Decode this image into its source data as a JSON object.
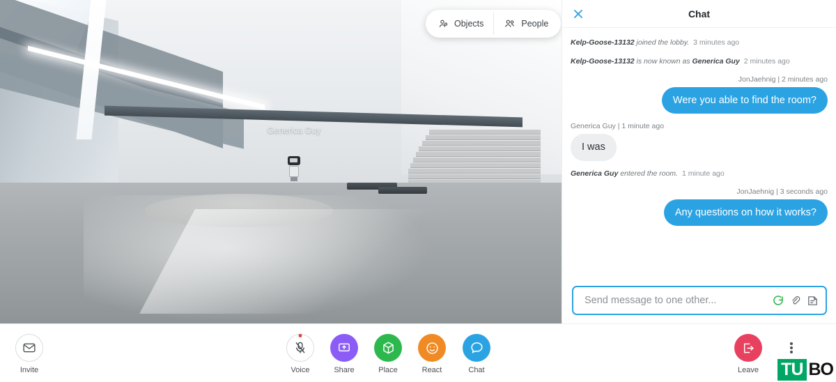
{
  "scene": {
    "avatar_name": "Generica Guy",
    "pills": [
      {
        "label": "Objects",
        "icon": "objects-icon"
      },
      {
        "label": "People",
        "icon": "people-icon"
      }
    ]
  },
  "chat": {
    "title": "Chat",
    "close_icon": "close-icon",
    "messages": [
      {
        "kind": "system",
        "who": "Kelp-Goose-13132",
        "text": "joined the lobby.",
        "time": "3 minutes ago"
      },
      {
        "kind": "system",
        "who": "Kelp-Goose-13132",
        "text": "is now known as",
        "who2": "Generica Guy",
        "time": "2 minutes ago"
      },
      {
        "kind": "message",
        "direction": "out",
        "meta": "JonJaehnig | 2 minutes ago",
        "text": "Were you able to find the room?"
      },
      {
        "kind": "message",
        "direction": "in",
        "meta": "Generica Guy | 1 minute ago",
        "text": "I was"
      },
      {
        "kind": "system",
        "who": "Generica Guy",
        "text": "entered the room.",
        "time": "1 minute ago"
      },
      {
        "kind": "message",
        "direction": "out",
        "meta": "JonJaehnig | 3 seconds ago",
        "text": "Any questions on how it works?"
      }
    ],
    "composer": {
      "value": "",
      "placeholder": "Send message to one other...",
      "spinner_icon": "loading-spinner-icon",
      "attach_icon": "paperclip-icon",
      "emoji_icon": "sticker-icon"
    }
  },
  "bottom_bar": {
    "items": [
      {
        "name": "invite",
        "label": "Invite",
        "icon": "envelope-icon",
        "color": "#ffffff",
        "style": "outline"
      },
      {
        "name": "voice",
        "label": "Voice",
        "icon": "microphone-muted-icon",
        "color": "#ffffff",
        "style": "outline",
        "badge": true
      },
      {
        "name": "share",
        "label": "Share",
        "icon": "screen-share-icon",
        "color": "#8b5cf6",
        "style": "solid"
      },
      {
        "name": "place",
        "label": "Place",
        "icon": "cube-icon",
        "color": "#2db84d",
        "style": "solid"
      },
      {
        "name": "react",
        "label": "React",
        "icon": "smiley-icon",
        "color": "#f08a24",
        "style": "solid"
      },
      {
        "name": "chat",
        "label": "Chat",
        "icon": "chat-bubble-icon",
        "color": "#2ba3e3",
        "style": "solid"
      },
      {
        "name": "leave",
        "label": "Leave",
        "icon": "exit-icon",
        "color": "#e8415f",
        "style": "solid"
      },
      {
        "name": "more",
        "label": "",
        "icon": "more-vertical-icon",
        "color": "#ffffff",
        "style": "plain"
      }
    ]
  },
  "watermark": {
    "green": "TU",
    "dark": "BO"
  },
  "colors": {
    "accent_blue": "#2ba3e3",
    "incoming_bubble": "#eceef0",
    "leave_red": "#e8415f",
    "share_purple": "#8b5cf6",
    "place_green": "#2db84d",
    "react_orange": "#f08a24"
  }
}
